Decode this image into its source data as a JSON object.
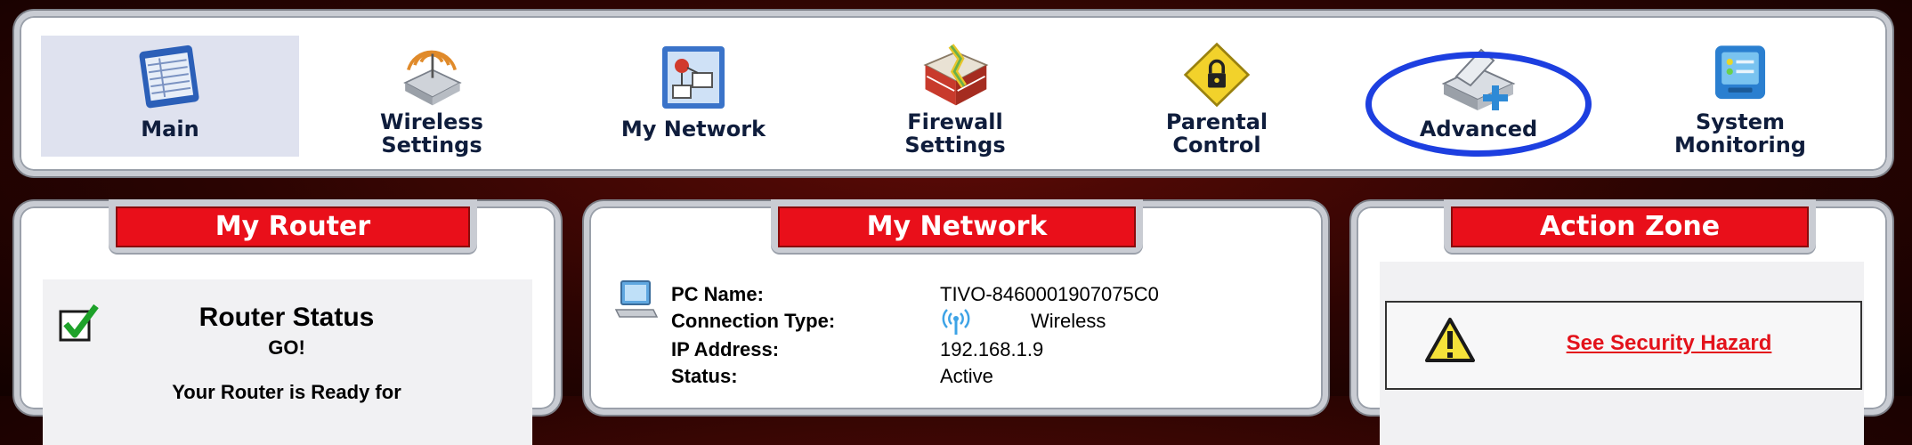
{
  "nav": {
    "items": [
      {
        "label": "Main",
        "icon": "main-icon"
      },
      {
        "label": "Wireless\nSettings",
        "icon": "wireless-icon"
      },
      {
        "label": "My Network",
        "icon": "network-icon"
      },
      {
        "label": "Firewall\nSettings",
        "icon": "firewall-icon"
      },
      {
        "label": "Parental\nControl",
        "icon": "lock-icon"
      },
      {
        "label": "Advanced",
        "icon": "advanced-icon"
      },
      {
        "label": "System\nMonitoring",
        "icon": "monitor-icon"
      }
    ],
    "active_index": 0,
    "highlighted_index": 5
  },
  "router": {
    "title": "My Router",
    "status_title": "Router Status",
    "status_value": "GO!",
    "ready_text": "Your Router is Ready for"
  },
  "network": {
    "title": "My Network",
    "rows": [
      {
        "label": "PC Name:",
        "value": "TIVO-8460001907075C0"
      },
      {
        "label": "Connection Type:",
        "value": "Wireless"
      },
      {
        "label": "IP Address:",
        "value": "192.168.1.9"
      },
      {
        "label": "Status:",
        "value": "Active"
      }
    ]
  },
  "action": {
    "title": "Action Zone",
    "link": "See Security Hazard"
  },
  "colors": {
    "accent_red": "#e90f1a",
    "highlight_blue": "#1d3fe0",
    "nav_text": "#0f1d3c"
  }
}
